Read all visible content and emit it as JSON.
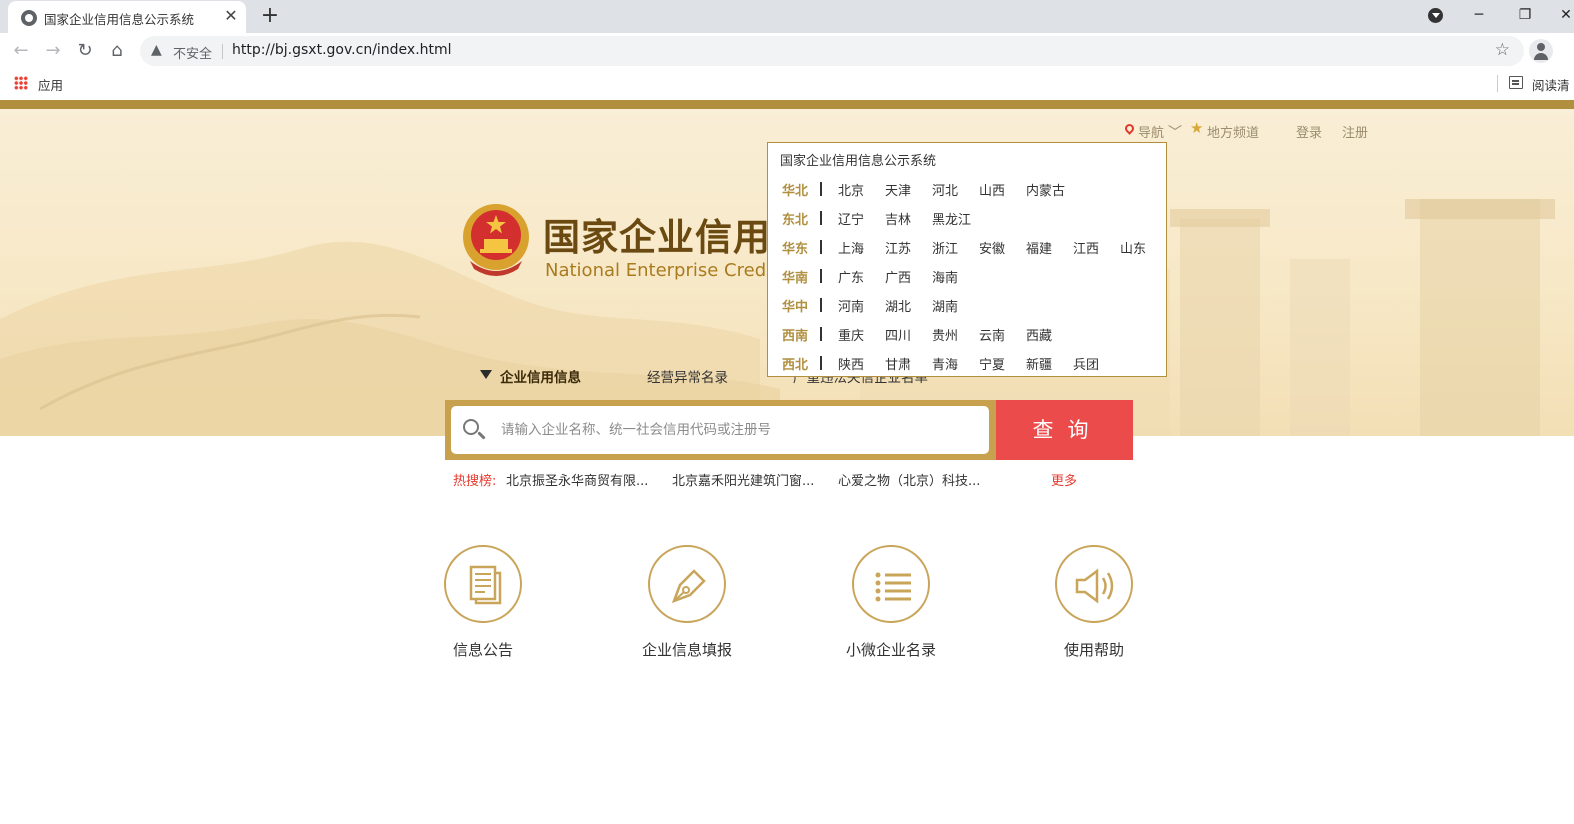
{
  "browser": {
    "tab_title": "国家企业信用信息公示系统",
    "close_glyph": "✕",
    "new_tab_glyph": "+",
    "insecure_label": "不安全",
    "url": "http://bj.gsxt.gov.cn/index.html",
    "bookmarks": {
      "apps_label": "应用",
      "reading_label": "阅读清"
    }
  },
  "header": {
    "nav_label": "导航",
    "local_channel_label": "地方频道",
    "login_label": "登录",
    "register_label": "注册",
    "title_cn": "国家企业信用",
    "title_en": "National Enterprise Credit"
  },
  "search": {
    "tabs": [
      {
        "label": "企业信用信息",
        "active": true
      },
      {
        "label": "经营异常名录",
        "active": false
      },
      {
        "label": "严重违法失信企业名单",
        "active": false
      }
    ],
    "placeholder": "请输入企业名称、统一社会信用代码或注册号",
    "button_label": "查询",
    "hot_label": "热搜榜:",
    "hot_items": [
      "北京振圣永华商贸有限...",
      "北京嘉禾阳光建筑门窗...",
      "心爱之物（北京）科技..."
    ],
    "more_label": "更多"
  },
  "quick_links": [
    {
      "label": "信息公告",
      "icon": "document-icon"
    },
    {
      "label": "企业信息填报",
      "icon": "pen-icon"
    },
    {
      "label": "小微企业名录",
      "icon": "list-icon"
    },
    {
      "label": "使用帮助",
      "icon": "speaker-icon"
    }
  ],
  "region_dropdown": {
    "title": "国家企业信用信息公示系统",
    "regions": [
      {
        "name": "华北",
        "provinces": [
          "北京",
          "天津",
          "河北",
          "山西",
          "内蒙古"
        ]
      },
      {
        "name": "东北",
        "provinces": [
          "辽宁",
          "吉林",
          "黑龙江"
        ]
      },
      {
        "name": "华东",
        "provinces": [
          "上海",
          "江苏",
          "浙江",
          "安徽",
          "福建",
          "江西",
          "山东"
        ]
      },
      {
        "name": "华南",
        "provinces": [
          "广东",
          "广西",
          "海南"
        ]
      },
      {
        "name": "华中",
        "provinces": [
          "河南",
          "湖北",
          "湖南"
        ]
      },
      {
        "name": "西南",
        "provinces": [
          "重庆",
          "四川",
          "贵州",
          "云南",
          "西藏"
        ]
      },
      {
        "name": "西北",
        "provinces": [
          "陕西",
          "甘肃",
          "青海",
          "宁夏",
          "新疆",
          "兵团"
        ]
      }
    ]
  },
  "colors": {
    "gold": "#b08f3f",
    "search_red": "#eb4b4b",
    "hot_red": "#e63a2e",
    "title_brown": "#6b4a12"
  }
}
